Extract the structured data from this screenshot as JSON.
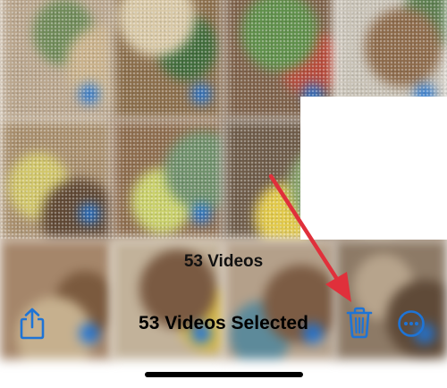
{
  "photos": {
    "count_label": "53 Videos",
    "tiles": [
      {
        "colors": [
          "#b9a58c",
          "#6f8a58",
          "#c9b18a"
        ]
      },
      {
        "colors": [
          "#8a6d4a",
          "#3f6b3a",
          "#d8c8a6"
        ]
      },
      {
        "colors": [
          "#7d6048",
          "#b84a3a",
          "#5f8f4a"
        ]
      },
      {
        "colors": [
          "#c8c2b6",
          "#5b7d4e",
          "#8d6a4a"
        ]
      },
      {
        "colors": [
          "#a78d6b",
          "#d1c66a",
          "#5e4632"
        ]
      },
      {
        "colors": [
          "#8c6b4c",
          "#c9d06a",
          "#6e8f6a"
        ]
      },
      {
        "colors": [
          "#6d5a47",
          "#e2c94a",
          "#86a26b"
        ]
      },
      {
        "colors": [
          "#9a7a5e",
          "#4e6a44",
          "#b5a17e"
        ]
      },
      {
        "colors": [
          "#a5866a",
          "#7b5a3e",
          "#c6b08e"
        ]
      },
      {
        "colors": [
          "#c2b29a",
          "#d6b84a",
          "#7a5a42"
        ]
      },
      {
        "colors": [
          "#b4a08a",
          "#5d8a9a",
          "#7c5c44"
        ]
      },
      {
        "colors": [
          "#8d7a66",
          "#b7a48c",
          "#5f4a38"
        ]
      }
    ],
    "selected_badge_color": "#1e74d6"
  },
  "toolbar": {
    "title": "53 Videos Selected",
    "share_icon": "share-icon",
    "trash_icon": "trash-icon",
    "more_icon": "more-icon"
  },
  "annotation": {
    "arrow_color": "#e0303b"
  },
  "accent_color": "#1e74d6"
}
